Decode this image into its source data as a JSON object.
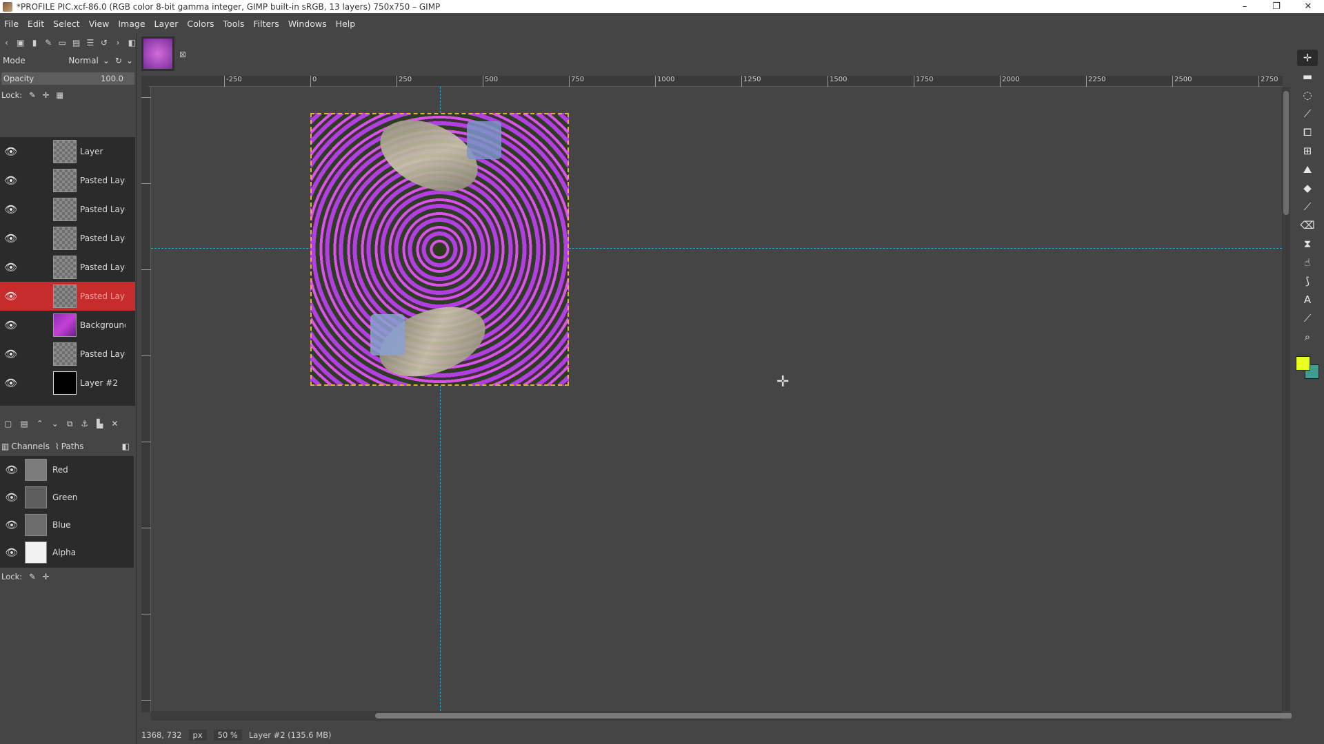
{
  "window": {
    "title": "*PROFILE PIC.xcf-86.0 (RGB color 8-bit gamma integer, GIMP built-in sRGB, 13 layers) 750x750 – GIMP",
    "controls": [
      "–",
      "❐",
      "✕"
    ]
  },
  "menubar": [
    "File",
    "Edit",
    "Select",
    "View",
    "Image",
    "Layer",
    "Colors",
    "Tools",
    "Filters",
    "Windows",
    "Help"
  ],
  "layers_panel": {
    "mode_label": "Mode",
    "mode_value": "Normal",
    "opacity_label": "Opacity",
    "opacity_value": "100.0",
    "lock_label": "Lock:",
    "layers": [
      {
        "name": "Layer",
        "thumb": "checker",
        "active": false
      },
      {
        "name": "Pasted Layer",
        "thumb": "checker",
        "active": false
      },
      {
        "name": "Pasted Layer",
        "thumb": "checker",
        "active": false
      },
      {
        "name": "Pasted Layer",
        "thumb": "checker",
        "active": false
      },
      {
        "name": "Pasted Layer",
        "thumb": "checker",
        "active": false
      },
      {
        "name": "Pasted Layer",
        "thumb": "checker",
        "active": true
      },
      {
        "name": "Background",
        "thumb": "bg",
        "active": false
      },
      {
        "name": "Pasted Layer",
        "thumb": "checker",
        "active": false
      },
      {
        "name": "Layer #2",
        "thumb": "black",
        "active": false
      }
    ]
  },
  "channels_panel": {
    "tabs": [
      "Channels",
      "Paths"
    ],
    "channels": [
      "Red",
      "Green",
      "Blue",
      "Alpha"
    ],
    "lock_label": "Lock:"
  },
  "rulers": {
    "h_labels": [
      "-250",
      "0",
      "250",
      "500",
      "750",
      "1000",
      "1250",
      "1500",
      "1750",
      "2000",
      "2250",
      "2500",
      "2750"
    ]
  },
  "statusbar": {
    "coords": "1368, 732",
    "unit": "px",
    "zoom": "50 %",
    "message": "Layer #2 (135.6 MB)"
  },
  "colors": {
    "foreground": "#e6ff1e",
    "background": "#3f9c91",
    "active_layer": "#c72c2c",
    "guide": "#2aa7c9"
  }
}
